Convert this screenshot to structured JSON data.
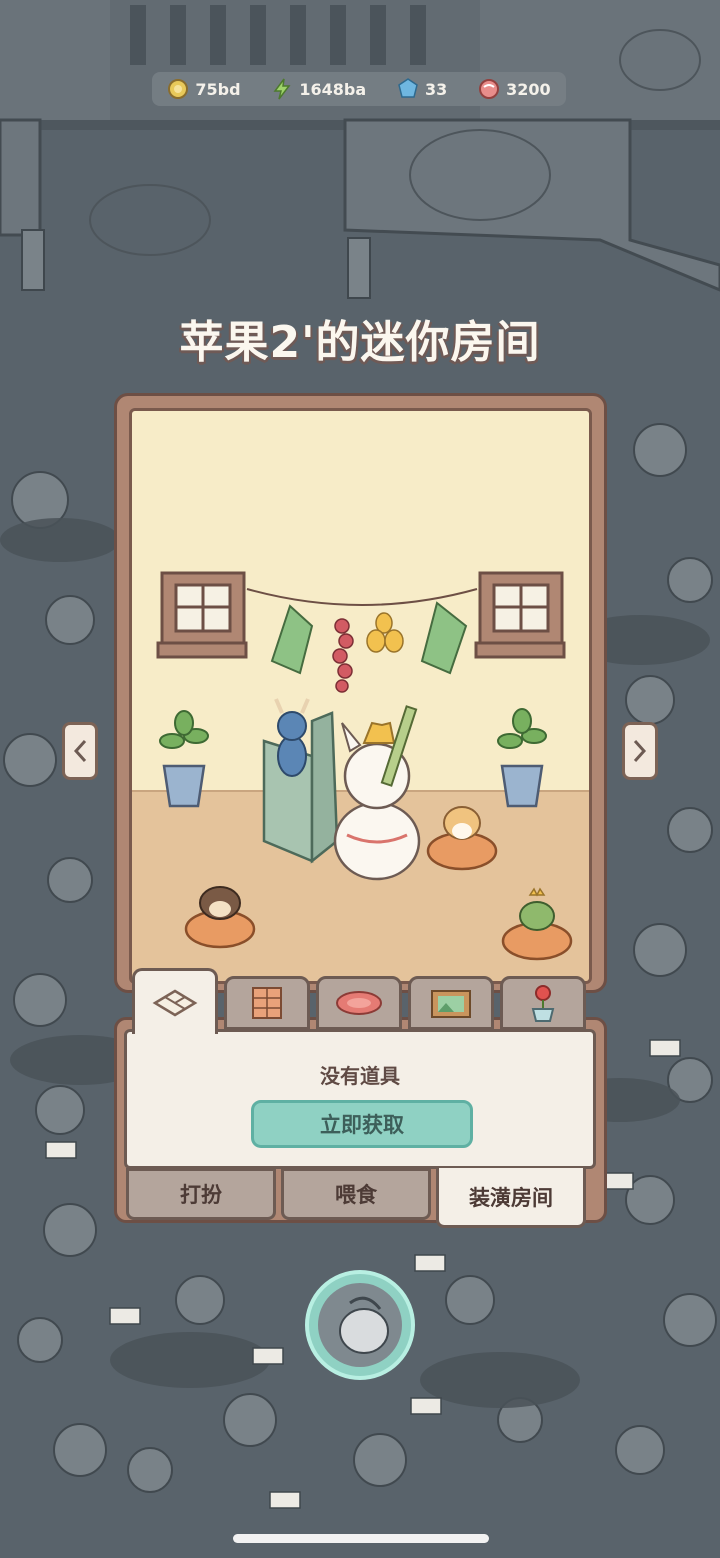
{
  "resources": [
    {
      "icon": "gold-coin-icon",
      "value": "75bd",
      "color": "#e8c95a"
    },
    {
      "icon": "energy-bolt-icon",
      "value": "1648ba",
      "color": "#9ed36a"
    },
    {
      "icon": "blue-gem-icon",
      "value": "33",
      "color": "#6fb7e0"
    },
    {
      "icon": "candy-icon",
      "value": "3200",
      "color": "#e88d8b"
    }
  ],
  "room": {
    "title": "苹果2'的迷你房间"
  },
  "decor_tabs": [
    {
      "icon": "floor-tile-icon",
      "active": true
    },
    {
      "icon": "wallpaper-scroll-icon",
      "active": false
    },
    {
      "icon": "plate-icon",
      "active": false
    },
    {
      "icon": "picture-frame-icon",
      "active": false
    },
    {
      "icon": "potted-flower-icon",
      "active": false
    }
  ],
  "panel": {
    "empty_text": "没有道具",
    "get_button": "立即获取"
  },
  "bottom_tabs": [
    {
      "label": "打扮",
      "active": false
    },
    {
      "label": "喂食",
      "active": false
    },
    {
      "label": "装潢房间",
      "active": true
    }
  ],
  "colors": {
    "accent": "#8fd1c3",
    "frame": "#b08773",
    "panel": "#f4efe7",
    "wall": "#f7ecc8",
    "floor": "#e4c39b"
  }
}
